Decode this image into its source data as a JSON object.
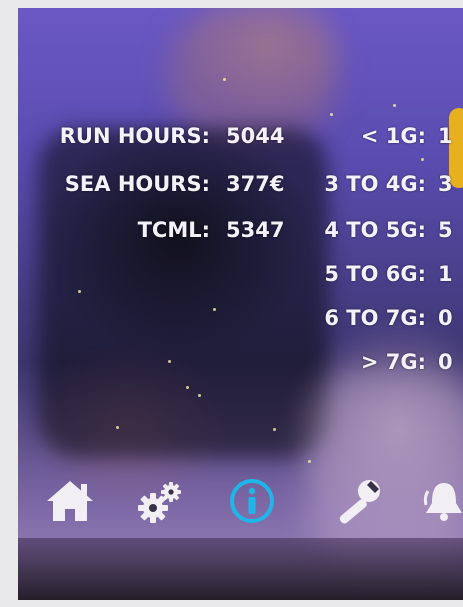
{
  "stats": [
    {
      "label": "RUN HOURS:",
      "value": "5044"
    },
    {
      "label": "SEA HOURS:",
      "value": "377€"
    },
    {
      "label": "TCML:",
      "value": "5347"
    }
  ],
  "g_force": [
    {
      "label": "< 1G:",
      "value": "1"
    },
    {
      "label": "3 TO 4G:",
      "value": "3"
    },
    {
      "label": "4 TO 5G:",
      "value": "5"
    },
    {
      "label": "5 TO 6G:",
      "value": "1"
    },
    {
      "label": "6 TO 7G:",
      "value": "0"
    },
    {
      "label": "> 7G:",
      "value": "0"
    }
  ],
  "nav": [
    {
      "icon": "home-icon"
    },
    {
      "icon": "gears-icon"
    },
    {
      "icon": "info-icon",
      "active": true
    },
    {
      "icon": "wrench-icon"
    },
    {
      "icon": "alarm-bell-icon"
    }
  ],
  "colors": {
    "accent": "#1eb6e8",
    "text": "#f4f2f8",
    "background": "#5a4cb0",
    "bezel_accent": "#e6b01e"
  }
}
